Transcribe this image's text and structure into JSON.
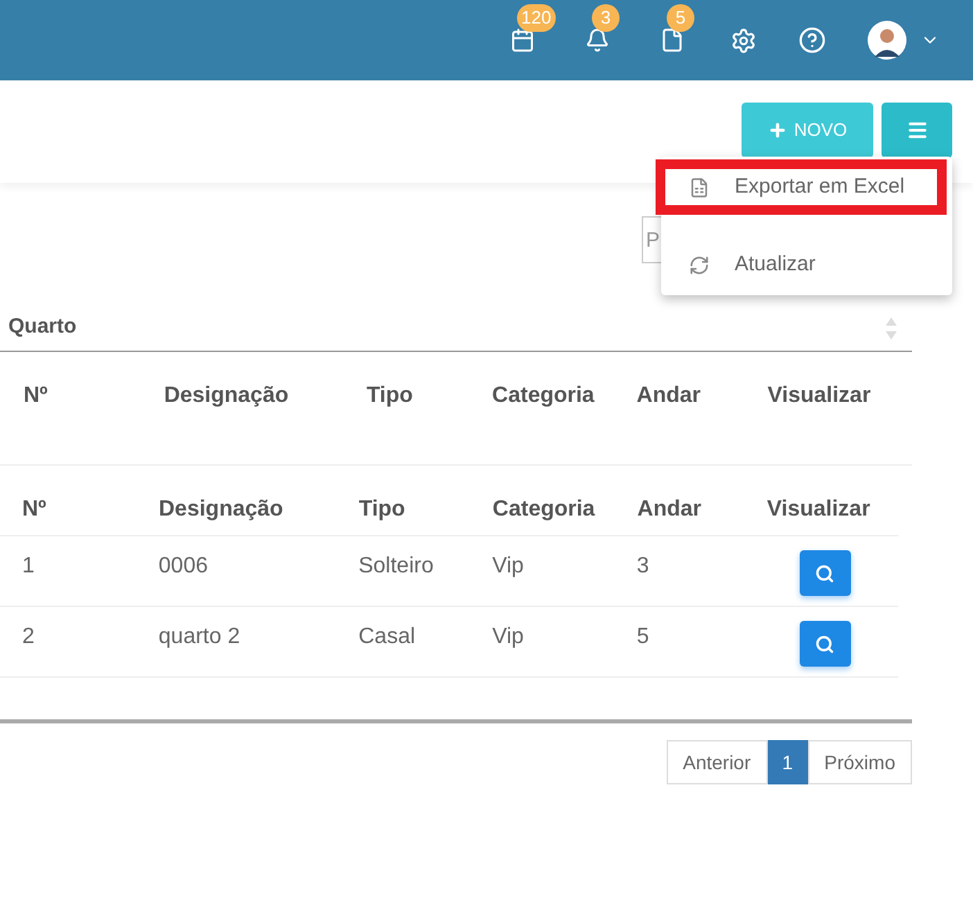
{
  "topbar": {
    "badges": [
      {
        "kind": "calendar",
        "count": "120"
      },
      {
        "kind": "bell",
        "count": "3"
      },
      {
        "kind": "document",
        "count": "5"
      }
    ]
  },
  "toolbar": {
    "new_button": "NOVO"
  },
  "menu": {
    "items": [
      {
        "kind": "excel",
        "label": "Exportar em Excel",
        "highlighted": true
      },
      {
        "kind": "refresh",
        "label": "Atualizar",
        "highlighted": false
      }
    ]
  },
  "search": {
    "placeholder": "P"
  },
  "table": {
    "group_header": "Quarto",
    "scroll_header": [
      "Nº",
      "Designação",
      "Tipo",
      "Categoria",
      "Andar",
      "Visualizar"
    ],
    "columns": [
      "Nº",
      "Designação",
      "Tipo",
      "Categoria",
      "Andar",
      "Visualizar"
    ],
    "rows": [
      [
        "1",
        "0006",
        "Solteiro",
        "Vip",
        "3"
      ],
      [
        "2",
        "quarto 2",
        "Casal",
        "Vip",
        "5"
      ]
    ]
  },
  "pagination": {
    "previous": "Anterior",
    "pages": [
      {
        "label": "1",
        "selected": true
      }
    ],
    "next": "Próximo"
  }
}
